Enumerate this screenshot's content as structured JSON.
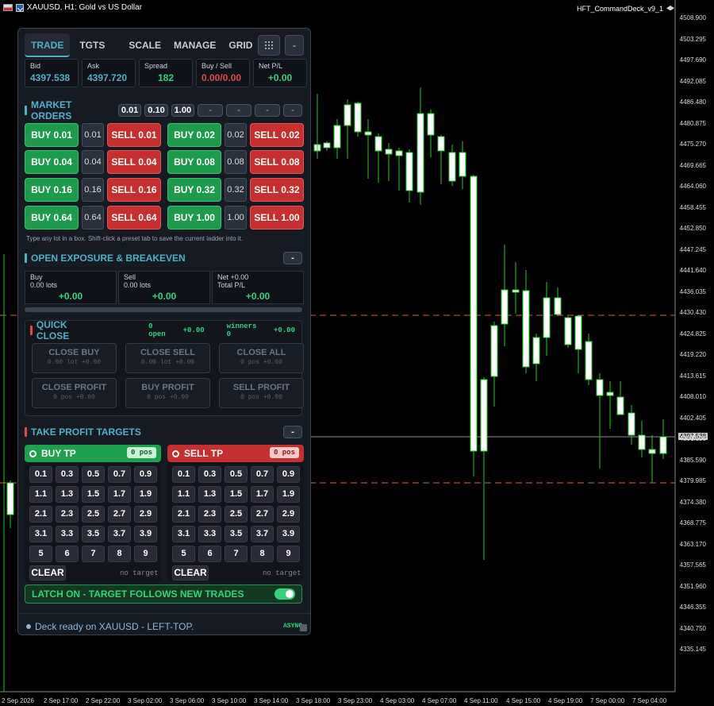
{
  "chart": {
    "symbol_title": "XAUUSD, H1:  Gold vs US Dollar",
    "ea_name": "HFT_CommandDeck_v9_1",
    "current_price_tag": "4397.538",
    "price_levels": [
      "4508.900",
      "4503.295",
      "4497.690",
      "4492.085",
      "4486.480",
      "4480.875",
      "4475.270",
      "4469.665",
      "4464.060",
      "4458.455",
      "4452.850",
      "4447.245",
      "4441.640",
      "4436.035",
      "4430.430",
      "4424.825",
      "4419.220",
      "4413.615",
      "4408.010",
      "4402.405",
      "4397.538",
      "4391.195",
      "4385.590",
      "4379.985",
      "4374.380",
      "4368.775",
      "4363.170",
      "4357.565",
      "4351.960",
      "4346.355",
      "4340.750",
      "4335.145"
    ],
    "time_labels": [
      "2 Sep 2026",
      "2 Sep 17:00",
      "2 Sep 22:00",
      "3 Sep 02:00",
      "3 Sep 06:00",
      "3 Sep 10:00",
      "3 Sep 14:00",
      "3 Sep 18:00",
      "3 Sep 23:00",
      "4 Sep 03:00",
      "4 Sep 07:00",
      "4 Sep 11:00",
      "4 Sep 15:00",
      "4 Sep 19:00",
      "7 Sep 00:00",
      "7 Sep 04:00"
    ],
    "dashed_line_color": "#e0603a",
    "bull_color": "#ffffff",
    "bear_color": "#ffffff",
    "wick_color": "#22cc22"
  },
  "tabs": [
    {
      "label": "TRADE",
      "active": true
    },
    {
      "label": "TGTS"
    },
    {
      "label": "SCALE"
    },
    {
      "label": "MANAGE"
    },
    {
      "label": "GRID"
    }
  ],
  "tab_buttons": {
    "grid_icon": "grid-icon",
    "minimize": "-"
  },
  "quotes": [
    {
      "label": "Bid",
      "value": "4397.538",
      "color": "#4fb0c6"
    },
    {
      "label": "Ask",
      "value": "4397.720",
      "color": "#4fb0c6"
    },
    {
      "label": "Spread",
      "value": "182",
      "color": "#34d27a"
    },
    {
      "label": "Buy / Sell",
      "value": "0.00/0.00",
      "color": "#e34a4a"
    },
    {
      "label": "Net P/L",
      "value": "+0.00",
      "color": "#34d27a"
    }
  ],
  "market_orders": {
    "title": "MARKET ORDERS",
    "presets": [
      "0.01",
      "0.10",
      "1.00",
      "-",
      "-",
      "-",
      "-"
    ],
    "rows": [
      {
        "buy_a": "BUY 0.01",
        "lot_a": "0.01",
        "sell_a": "SELL 0.01",
        "buy_b": "BUY 0.02",
        "lot_b": "0.02",
        "sell_b": "SELL 0.02"
      },
      {
        "buy_a": "BUY 0.04",
        "lot_a": "0.04",
        "sell_a": "SELL 0.04",
        "buy_b": "BUY 0.08",
        "lot_b": "0.08",
        "sell_b": "SELL 0.08"
      },
      {
        "buy_a": "BUY 0.16",
        "lot_a": "0.16",
        "sell_a": "SELL 0.16",
        "buy_b": "BUY 0.32",
        "lot_b": "0.32",
        "sell_b": "SELL 0.32"
      },
      {
        "buy_a": "BUY 0.64",
        "lot_a": "0.64",
        "sell_a": "SELL 0.64",
        "buy_b": "BUY 1.00",
        "lot_b": "1.00",
        "sell_b": "SELL 1.00"
      }
    ],
    "hint": "Type any lot in a box. Shift-click a preset tab to save the current ladder into it."
  },
  "exposure": {
    "title": "OPEN EXPOSURE & BREAKEVEN",
    "collapse": "-",
    "buy": {
      "label": "Buy",
      "sub": "0.00 lots",
      "value": "+0.00"
    },
    "sell": {
      "label": "Sell",
      "sub": "0.00 lots",
      "value": "+0.00"
    },
    "net": {
      "label": "Net +0.00",
      "sub": "Total P/L",
      "value": "+0.00"
    }
  },
  "quick_close": {
    "title": "QUICK CLOSE",
    "open_count": "0 open",
    "open_pl": "+0.00",
    "winners": "winners 0",
    "winners_pl": "+0.00",
    "buttons": [
      {
        "label": "CLOSE BUY",
        "sub": "0.00 lot  +0.00"
      },
      {
        "label": "CLOSE SELL",
        "sub": "0.00 lot  +0.00"
      },
      {
        "label": "CLOSE ALL",
        "sub": "0 pos  +0.00"
      },
      {
        "label": "CLOSE PROFIT",
        "sub": "0 pos  +0.00"
      },
      {
        "label": "BUY PROFIT",
        "sub": "0 pos  +0.00"
      },
      {
        "label": "SELL PROFIT",
        "sub": "0 pos  +0.00"
      }
    ]
  },
  "take_profit": {
    "title": "TAKE PROFIT TARGETS",
    "collapse": "-",
    "buy": {
      "label": "BUY TP",
      "count": "0 pos",
      "color": "#1ea14f",
      "count_bg": "#c7f3d6",
      "count_color": "#0d5a2a"
    },
    "sell": {
      "label": "SELL TP",
      "count": "0 pos",
      "color": "#c62f2f",
      "count_bg": "#f7c9c9",
      "count_color": "#8a1414"
    },
    "grid": [
      "0.1",
      "0.3",
      "0.5",
      "0.7",
      "0.9",
      "1.1",
      "1.3",
      "1.5",
      "1.7",
      "1.9",
      "2.1",
      "2.3",
      "2.5",
      "2.7",
      "2.9",
      "3.1",
      "3.3",
      "3.5",
      "3.7",
      "3.9",
      "5",
      "6",
      "7",
      "8",
      "9"
    ],
    "clear": "CLEAR",
    "no_target": "no target"
  },
  "latch": {
    "label": "LATCH ON - TARGET FOLLOWS NEW TRADES",
    "on": true
  },
  "status": {
    "text": "Deck ready on XAUUSD - LEFT-TOP.",
    "mode": "ASYNC"
  }
}
